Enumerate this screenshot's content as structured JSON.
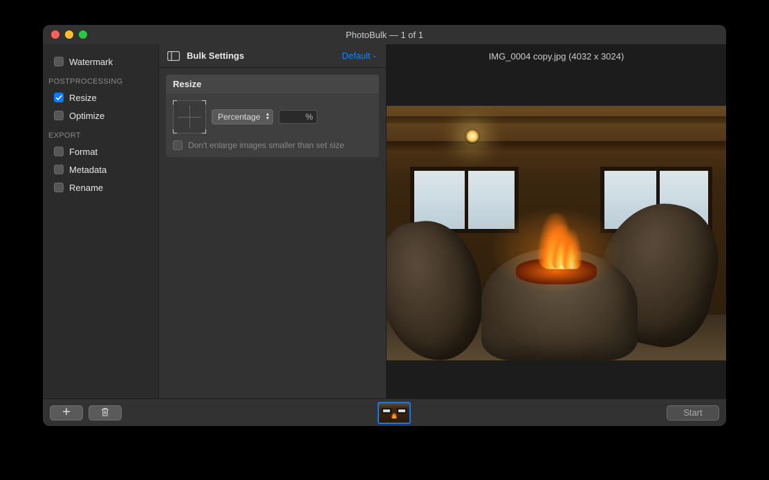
{
  "window": {
    "title": "PhotoBulk — 1 of 1"
  },
  "sidebar": {
    "watermark": {
      "label": "Watermark",
      "checked": false
    },
    "section_postprocessing": "POSTPROCESSING",
    "resize": {
      "label": "Resize",
      "checked": true
    },
    "optimize": {
      "label": "Optimize",
      "checked": false
    },
    "section_export": "EXPORT",
    "format": {
      "label": "Format",
      "checked": false
    },
    "metadata": {
      "label": "Metadata",
      "checked": false
    },
    "rename": {
      "label": "Rename",
      "checked": false
    }
  },
  "settings": {
    "header_label": "Bulk Settings",
    "preset_label": "Default",
    "resize_panel": {
      "title": "Resize",
      "mode_selected": "Percentage",
      "value": "",
      "unit": "%",
      "dont_enlarge_label": "Don't enlarge images smaller than set size",
      "dont_enlarge_checked": false
    }
  },
  "preview": {
    "filename_line": "IMG_0004 copy.jpg (4032 x 3024)"
  },
  "footer": {
    "start_label": "Start"
  }
}
